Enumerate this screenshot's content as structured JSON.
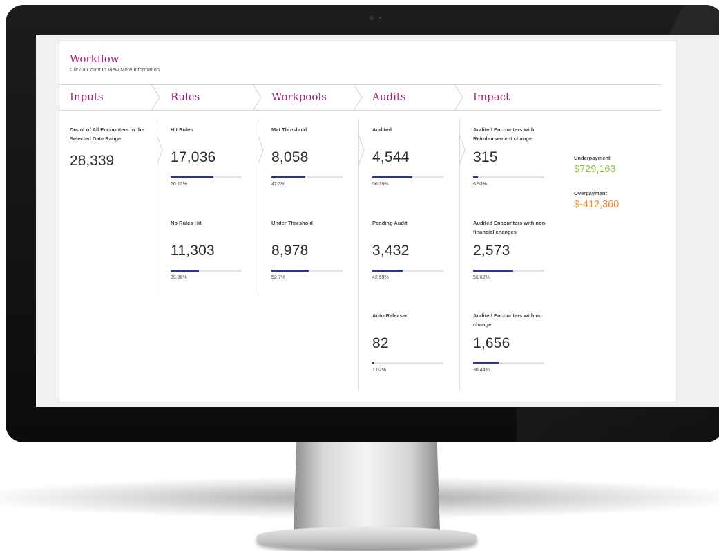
{
  "workflow": {
    "title": "Workflow",
    "subtitle": "Click a Count to View More Information"
  },
  "steps": [
    "Inputs",
    "Rules",
    "Workpools",
    "Audits",
    "Impact"
  ],
  "inputs": {
    "label": "Count of All Encounters in the Selected Date Range",
    "value": "28,339"
  },
  "rules": [
    {
      "label": "Hit Rules",
      "value": "17,036",
      "percent_text": "60.12%",
      "fraction": 0.6012
    },
    {
      "label": "No Rules Hit",
      "value": "11,303",
      "percent_text": "39.88%",
      "fraction": 0.3988
    }
  ],
  "workpools": [
    {
      "label": "Met Threshold",
      "value": "8,058",
      "percent_text": "47.3%",
      "fraction": 0.473
    },
    {
      "label": "Under Threshold",
      "value": "8,978",
      "percent_text": "52.7%",
      "fraction": 0.527
    }
  ],
  "audits": [
    {
      "label": "Audited",
      "value": "4,544",
      "percent_text": "56.39%",
      "fraction": 0.5639
    },
    {
      "label": "Pending Audit",
      "value": "3,432",
      "percent_text": "42.59%",
      "fraction": 0.4259
    },
    {
      "label": "Auto-Released",
      "value": "82",
      "percent_text": "1.02%",
      "fraction": 0.0102
    }
  ],
  "impact": [
    {
      "label": "Audited Encounters with Reimbursement change",
      "value": "315",
      "percent_text": "6.93%",
      "fraction": 0.0693
    },
    {
      "label": "Audited Encounters with non-financial changes",
      "value": "2,573",
      "percent_text": "56.62%",
      "fraction": 0.5662
    },
    {
      "label": "Audited Encounters with no change",
      "value": "1,656",
      "percent_text": "36.44%",
      "fraction": 0.3644
    }
  ],
  "financial": {
    "underpayment_label": "Underpayment",
    "underpayment_value": "$729,163",
    "overpayment_label": "Overpayment",
    "overpayment_value": "$-412,360"
  },
  "colors": {
    "brand": "#a3237b",
    "bar": "#2a3990",
    "underpayment": "#8cbf3f",
    "overpayment": "#f08a24"
  }
}
